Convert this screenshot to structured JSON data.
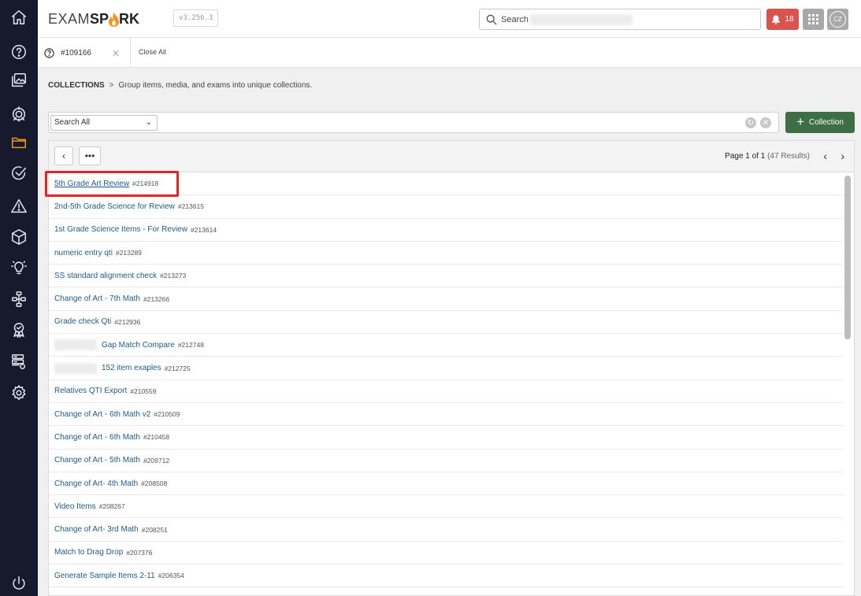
{
  "app": {
    "logo_exam": "EXAM",
    "logo_spark_a": "SP",
    "logo_spark_b": "RK",
    "version": "v3.256.3"
  },
  "header": {
    "search_label": "Search",
    "notification_count": "18",
    "avatar_initials": "CZ"
  },
  "tabs": {
    "open_tab": "#109166",
    "close_all": "Close All"
  },
  "breadcrumb": {
    "section": "COLLECTIONS",
    "separator": ">",
    "description": "Group items, media, and exams into unique collections."
  },
  "filter": {
    "scope": "Search All",
    "add_button": "Collection"
  },
  "pager": {
    "page": "Page 1 of 1",
    "results": "(47 Results)"
  },
  "sidebar": {
    "icons": [
      "home-icon",
      "help-icon",
      "media-icon",
      "target-icon",
      "folder-icon",
      "check-circle-icon",
      "warning-icon",
      "cube-icon",
      "lightbulb-icon",
      "workflow-icon",
      "award-icon",
      "server-icon",
      "settings-icon",
      "power-icon"
    ],
    "active": "folder-icon"
  },
  "colors": {
    "sidebar": "#161a2c",
    "active_icon": "#f29520",
    "notification": "#d9534f",
    "primary_button": "#3e6e43",
    "link": "#215c8f",
    "highlight": "#e12424"
  },
  "collections": [
    {
      "title": "5th Grade Art Review",
      "id": "#214918"
    },
    {
      "title": "2nd-5th Grade Science for Review",
      "id": "#213615"
    },
    {
      "title": "1st Grade Science Items - For Review",
      "id": "#213614"
    },
    {
      "title": "numeric entry qti",
      "id": "#213289"
    },
    {
      "title": "SS standard alignment check",
      "id": "#213273"
    },
    {
      "title": "Change of Art - 7th Math",
      "id": "#213266"
    },
    {
      "title": "Grade check Qti",
      "id": "#212936"
    },
    {
      "title": "Gap Match Compare",
      "id": "#212748"
    },
    {
      "title": "152 item exaples",
      "id": "#212725"
    },
    {
      "title": "Relatives QTI Export",
      "id": "#210559"
    },
    {
      "title": "Change of Art - 6th Math v2",
      "id": "#210509"
    },
    {
      "title": "Change of Art - 6th Math",
      "id": "#210458"
    },
    {
      "title": "Change of Art - 5th Math",
      "id": "#209712"
    },
    {
      "title": "Change of Art- 4th Math",
      "id": "#208508"
    },
    {
      "title": "Video Items",
      "id": "#208267"
    },
    {
      "title": "Change of Art- 3rd Math",
      "id": "#208251"
    },
    {
      "title": "Match to Drag Drop",
      "id": "#207376"
    },
    {
      "title": "Generate Sample Items 2-11",
      "id": "#206354"
    }
  ]
}
